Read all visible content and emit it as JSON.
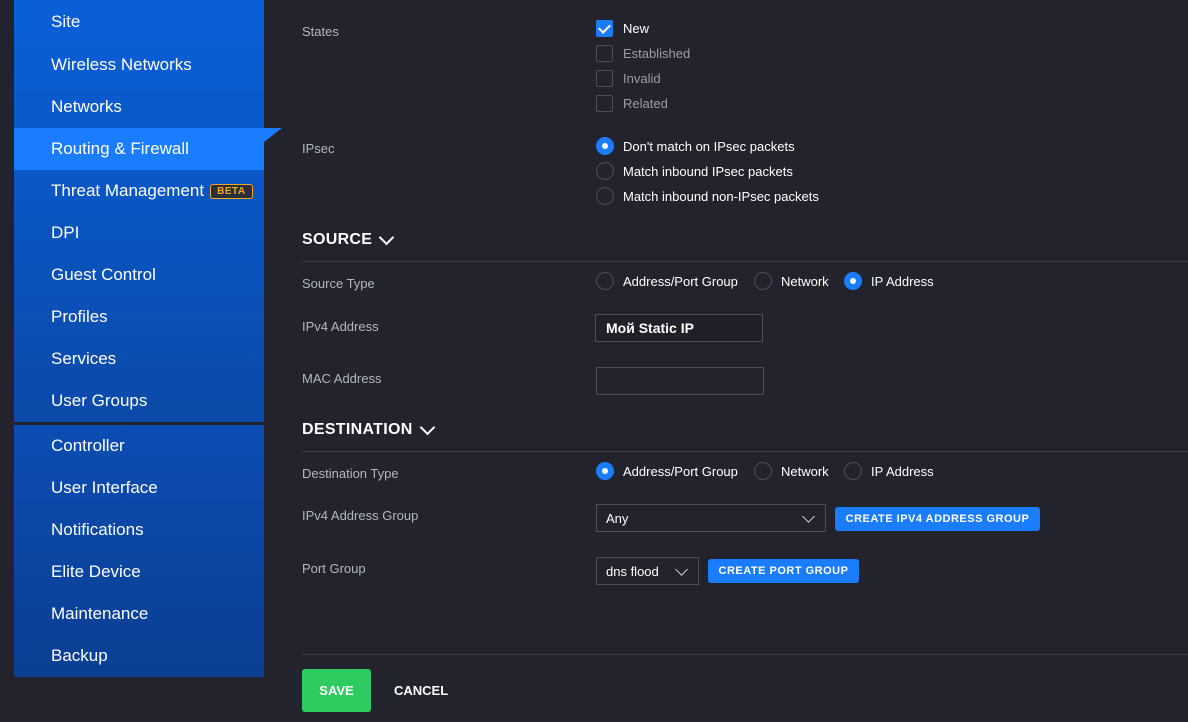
{
  "sidebar": {
    "group1": [
      {
        "label": "Site"
      },
      {
        "label": "Wireless Networks"
      },
      {
        "label": "Networks"
      },
      {
        "label": "Routing & Firewall",
        "active": true
      },
      {
        "label": "Threat Management",
        "badge": "BETA"
      },
      {
        "label": "DPI"
      },
      {
        "label": "Guest Control"
      },
      {
        "label": "Profiles"
      },
      {
        "label": "Services"
      },
      {
        "label": "User Groups"
      }
    ],
    "group2": [
      {
        "label": "Controller"
      },
      {
        "label": "User Interface"
      },
      {
        "label": "Notifications"
      },
      {
        "label": "Elite Device"
      },
      {
        "label": "Maintenance"
      },
      {
        "label": "Backup"
      }
    ]
  },
  "states": {
    "label": "States",
    "options": [
      {
        "label": "New",
        "checked": true
      },
      {
        "label": "Established",
        "checked": false
      },
      {
        "label": "Invalid",
        "checked": false
      },
      {
        "label": "Related",
        "checked": false
      }
    ]
  },
  "ipsec": {
    "label": "IPsec",
    "options": [
      {
        "label": "Don't match on IPsec packets",
        "selected": true
      },
      {
        "label": "Match inbound IPsec packets",
        "selected": false
      },
      {
        "label": "Match inbound non-IPsec packets",
        "selected": false
      }
    ]
  },
  "source": {
    "heading": "SOURCE",
    "type_label": "Source Type",
    "type_options": [
      {
        "label": "Address/Port Group",
        "selected": false
      },
      {
        "label": "Network",
        "selected": false
      },
      {
        "label": "IP Address",
        "selected": true
      }
    ],
    "ipv4_label": "IPv4 Address",
    "ipv4_value": "Мой Static IP",
    "mac_label": "MAC Address",
    "mac_value": ""
  },
  "destination": {
    "heading": "DESTINATION",
    "type_label": "Destination Type",
    "type_options": [
      {
        "label": "Address/Port Group",
        "selected": true
      },
      {
        "label": "Network",
        "selected": false
      },
      {
        "label": "IP Address",
        "selected": false
      }
    ],
    "group_label": "IPv4 Address Group",
    "group_value": "Any",
    "create_group_button": "CREATE IPV4 ADDRESS GROUP",
    "port_label": "Port Group",
    "port_value": "dns flood",
    "create_port_button": "CREATE PORT GROUP"
  },
  "actions": {
    "save": "SAVE",
    "cancel": "CANCEL"
  },
  "colors": {
    "background": "#22232d",
    "accent": "#1a7cff",
    "save": "#2ecc60",
    "beta": "#f5a623"
  }
}
